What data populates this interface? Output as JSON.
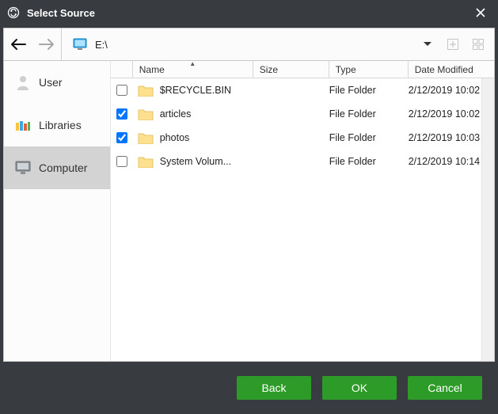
{
  "titlebar": {
    "title": "Select Source"
  },
  "toolbar": {
    "path": "E:\\"
  },
  "sidebar": {
    "items": [
      {
        "label": "User"
      },
      {
        "label": "Libraries"
      },
      {
        "label": "Computer"
      }
    ]
  },
  "columns": {
    "name": "Name",
    "size": "Size",
    "type": "Type",
    "date": "Date Modified"
  },
  "rows": [
    {
      "checked": false,
      "name": "$RECYCLE.BIN",
      "size": "",
      "type": "File Folder",
      "date": "2/12/2019 10:02 ..."
    },
    {
      "checked": true,
      "name": "articles",
      "size": "",
      "type": "File Folder",
      "date": "2/12/2019 10:02 ..."
    },
    {
      "checked": true,
      "name": "photos",
      "size": "",
      "type": "File Folder",
      "date": "2/12/2019 10:03 ..."
    },
    {
      "checked": false,
      "name": "System Volum...",
      "size": "",
      "type": "File Folder",
      "date": "2/12/2019 10:14 ..."
    }
  ],
  "footer": {
    "back": "Back",
    "ok": "OK",
    "cancel": "Cancel"
  }
}
